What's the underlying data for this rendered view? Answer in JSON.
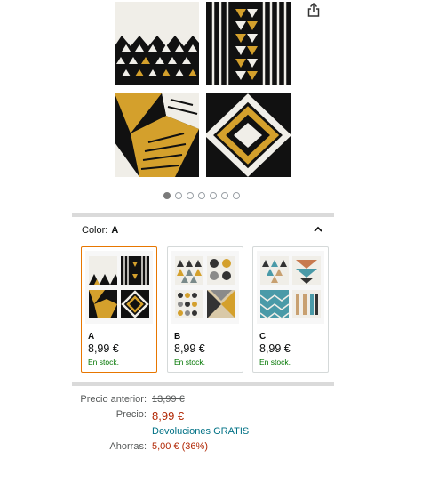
{
  "gallery": {
    "share_icon": "share-icon",
    "dot_count": 7,
    "active_dot": 1
  },
  "color": {
    "label": "Color:",
    "value": "A",
    "toggle_icon": "chevron-up-icon"
  },
  "variants": [
    {
      "name": "A",
      "price": "8,99 €",
      "stock": "En stock.",
      "selected": true
    },
    {
      "name": "B",
      "price": "8,99 €",
      "stock": "En stock.",
      "selected": false
    },
    {
      "name": "C",
      "price": "8,99 €",
      "stock": "En stock.",
      "selected": false
    }
  ],
  "pricing": {
    "old_label": "Precio anterior:",
    "old_value": "13,99 €",
    "price_label": "Precio:",
    "price_value": "8,99 €",
    "returns": "Devoluciones GRATIS",
    "savings_label": "Ahorras:",
    "savings_value": "5,00 € (36%)"
  },
  "colors": {
    "accent_selected": "#e77600",
    "price_red": "#b12704",
    "stock_green": "#007600",
    "link_teal": "#007185",
    "mustard": "#d4a02c"
  }
}
